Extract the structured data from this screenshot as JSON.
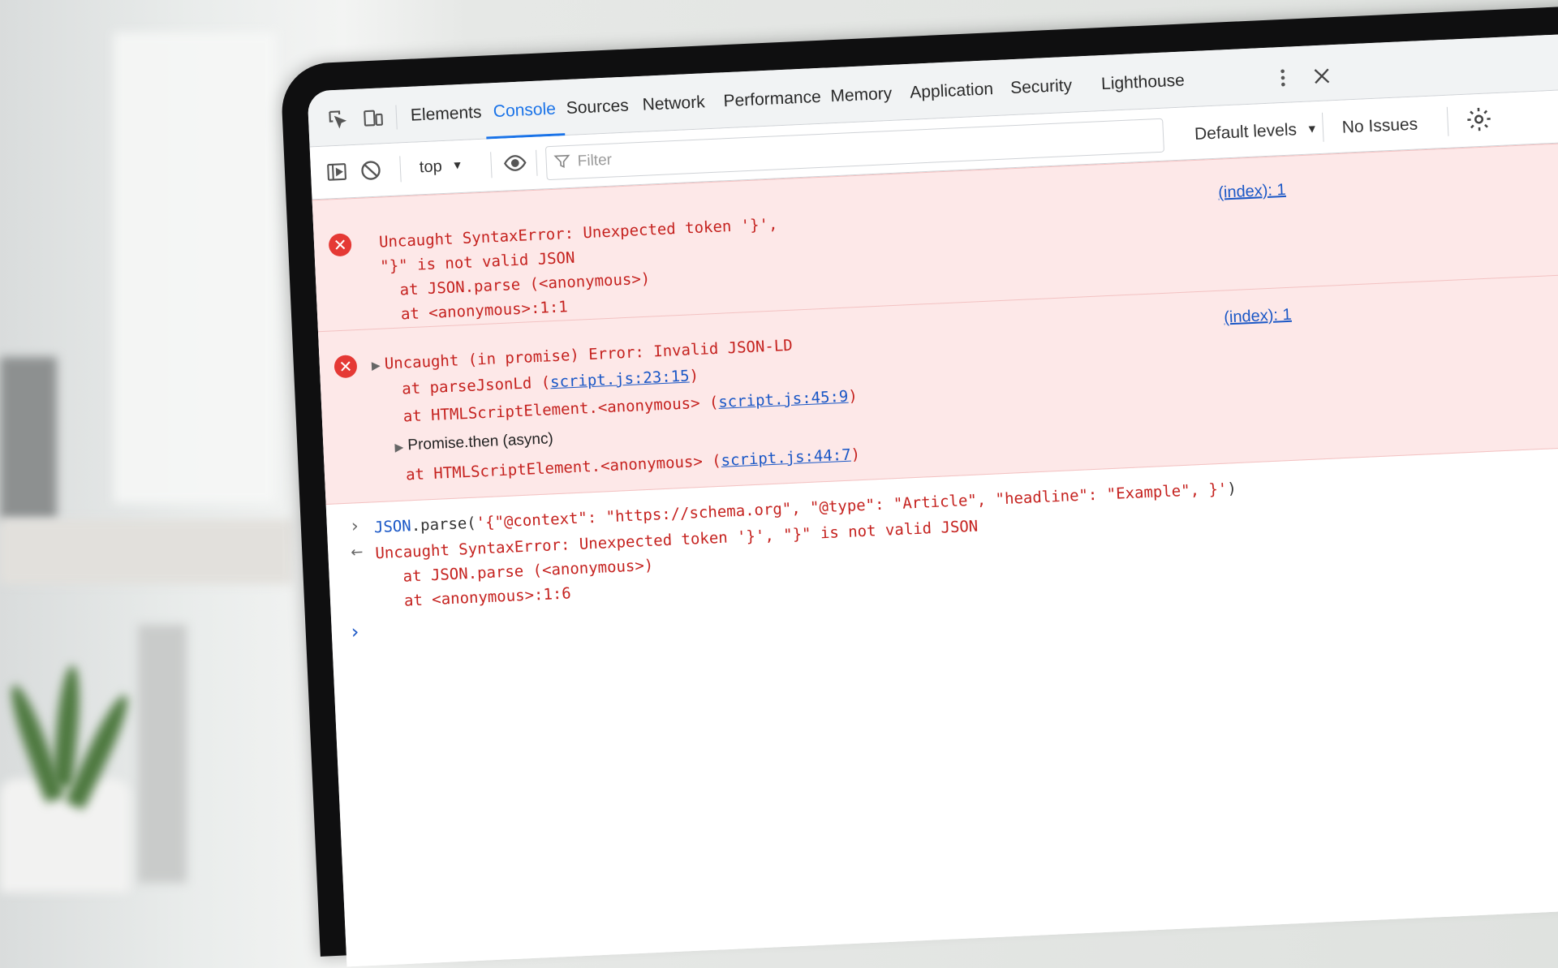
{
  "tabs": [
    {
      "label": "Elements"
    },
    {
      "label": "Console"
    },
    {
      "label": "Sources"
    },
    {
      "label": "Network"
    },
    {
      "label": "Performance"
    },
    {
      "label": "Memory"
    },
    {
      "label": "Application"
    },
    {
      "label": "Security"
    },
    {
      "label": "Lighthouse"
    }
  ],
  "active_tab": "Console",
  "toolbar": {
    "context": "top",
    "filter_placeholder": "Filter",
    "levels": "Default levels",
    "issues": "No Issues"
  },
  "errors": [
    {
      "lines": [
        "Uncaught SyntaxError: Unexpected token '}',",
        "\"}\" is not valid JSON",
        "  at JSON.parse (<anonymous>)",
        "  at <anonymous>:1:1"
      ],
      "source": "(index): 1"
    },
    {
      "title": "Uncaught (in promise) Error: Invalid JSON-LD",
      "frames": [
        {
          "prefix": "at parseJsonLd (",
          "link": "script.js:23:15",
          "suffix": ")"
        },
        {
          "prefix": "at HTMLScriptElement.<anonymous> (",
          "link": "script.js:45:9",
          "suffix": ")"
        },
        {
          "async": "Promise.then (async)"
        },
        {
          "prefix": "at HTMLScriptElement.<anonymous> (",
          "link": "script.js:44:7",
          "suffix": ")"
        }
      ],
      "source": "(index): 1"
    }
  ],
  "input": {
    "object": "JSON",
    "method": ".parse(",
    "argument": "'{\"@context\": \"https://schema.org\", \"@type\": \"Article\", \"headline\": \"Example\", }'",
    "close": ")"
  },
  "result": {
    "lines": [
      "Uncaught SyntaxError: Unexpected token '}', \"}\" is not valid JSON",
      "  at JSON.parse (<anonymous>)",
      "  at <anonymous>:1:6"
    ]
  },
  "icons": {
    "inspect": "inspect-element-icon",
    "device": "device-toolbar-icon",
    "sidebar": "sidebar-toggle-icon",
    "clear": "clear-console-icon",
    "eye": "live-expression-icon",
    "filter": "filter-icon",
    "settings": "gear-icon",
    "more": "more-vert-icon",
    "close": "close-icon"
  },
  "colors": {
    "accent": "#1a73e8",
    "error_text": "#c5221f",
    "error_bg": "#fde8e8"
  }
}
